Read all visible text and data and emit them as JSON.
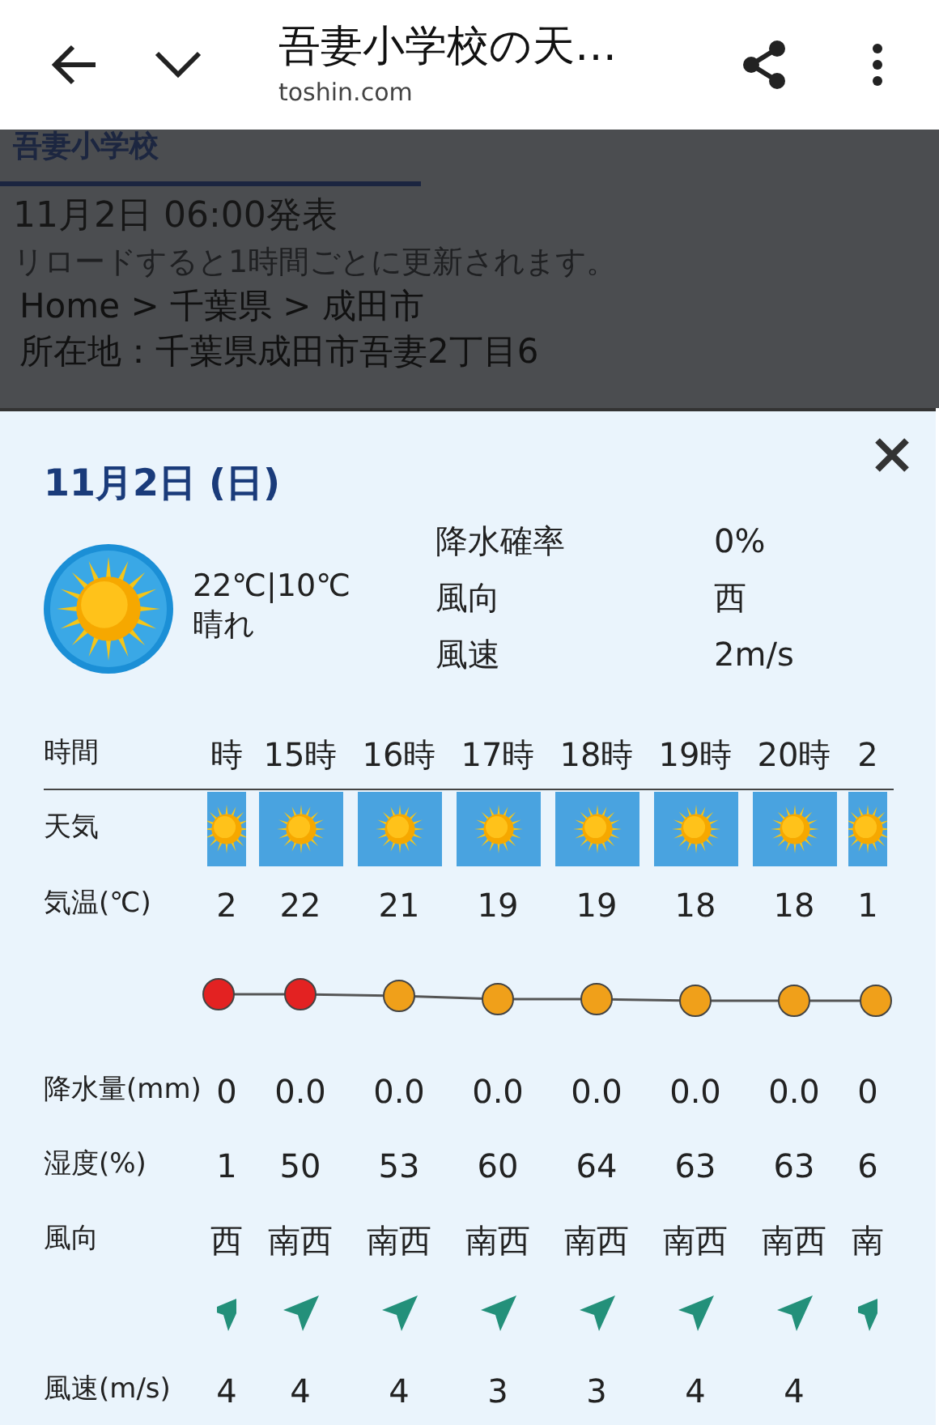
{
  "browser_bar": {
    "title": "吾妻小学校の天…",
    "domain": "toshin.com"
  },
  "page": {
    "heading": "吾妻小学校",
    "issued": "11月2日 06:00発表",
    "note": "リロードすると1時間ごとに更新されます。",
    "breadcrumb": "Home > 千葉県 > 成田市",
    "address": "所在地：千葉県成田市吾妻2丁目6"
  },
  "detail": {
    "date": "11月2日 (日)",
    "temps": "22℃|10℃",
    "weather": "晴れ",
    "stats": [
      {
        "label": "降水確率",
        "value": "0%"
      },
      {
        "label": "風向",
        "value": "西"
      },
      {
        "label": "風速",
        "value": "2m/s"
      }
    ],
    "table": {
      "row_labels": {
        "time": "時間",
        "weather": "天気",
        "temp": "気温(℃)",
        "precip": "降水量(mm)",
        "humidity": "湿度(%)",
        "wind_dir": "風向",
        "wind_speed": "風速(m/s)"
      },
      "columns": [
        {
          "kind": "partial",
          "time": "時",
          "temp": "2",
          "color": "#e32222",
          "precip": "0",
          "humidity": "1",
          "wind_dir": "西",
          "wind_speed": "4"
        },
        {
          "kind": "full",
          "time": "15時",
          "temp": "22",
          "color": "#e32222",
          "precip": "0.0",
          "humidity": "50",
          "wind_dir": "南西",
          "wind_speed": "4"
        },
        {
          "kind": "full",
          "time": "16時",
          "temp": "21",
          "color": "#f0a01a",
          "precip": "0.0",
          "humidity": "53",
          "wind_dir": "南西",
          "wind_speed": "4"
        },
        {
          "kind": "full",
          "time": "17時",
          "temp": "19",
          "color": "#f0a01a",
          "precip": "0.0",
          "humidity": "60",
          "wind_dir": "南西",
          "wind_speed": "3"
        },
        {
          "kind": "full",
          "time": "18時",
          "temp": "19",
          "color": "#f0a01a",
          "precip": "0.0",
          "humidity": "64",
          "wind_dir": "南西",
          "wind_speed": "3"
        },
        {
          "kind": "full",
          "time": "19時",
          "temp": "18",
          "color": "#f0a01a",
          "precip": "0.0",
          "humidity": "63",
          "wind_dir": "南西",
          "wind_speed": "4"
        },
        {
          "kind": "full",
          "time": "20時",
          "temp": "18",
          "color": "#f0a01a",
          "precip": "0.0",
          "humidity": "63",
          "wind_dir": "南西",
          "wind_speed": "4"
        },
        {
          "kind": "partial",
          "time": "2",
          "temp": "1",
          "color": "#f0a01a",
          "precip": "0",
          "humidity": "6",
          "wind_dir": "南"
        }
      ]
    }
  }
}
